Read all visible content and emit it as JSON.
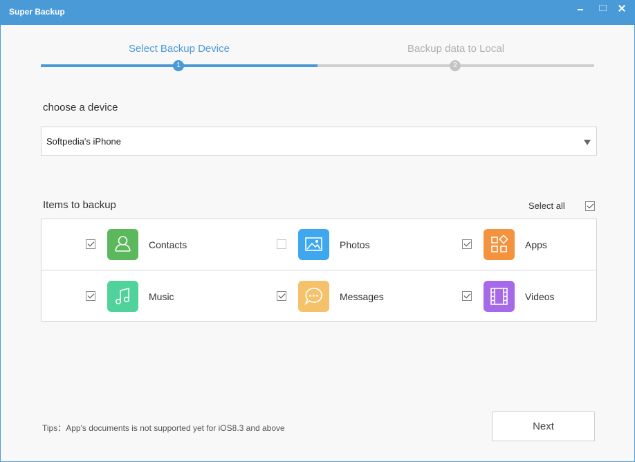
{
  "window": {
    "title": "Super Backup"
  },
  "steps": [
    {
      "number": "1",
      "label": "Select Backup Device",
      "active": true
    },
    {
      "number": "2",
      "label": "Backup data to Local",
      "active": false
    }
  ],
  "device": {
    "heading": "choose a device",
    "selected": "Softpedia's iPhone"
  },
  "backup": {
    "heading": "Items to backup",
    "select_all_label": "Select all",
    "select_all_checked": true,
    "items": [
      {
        "label": "Contacts",
        "checked": true,
        "icon": "contacts-icon",
        "color": "#5cb85c"
      },
      {
        "label": "Photos",
        "checked": false,
        "icon": "photos-icon",
        "color": "#3fa7ee"
      },
      {
        "label": "Apps",
        "checked": true,
        "icon": "apps-icon",
        "color": "#f5923e"
      },
      {
        "label": "Music",
        "checked": true,
        "icon": "music-icon",
        "color": "#4fd39a"
      },
      {
        "label": "Messages",
        "checked": true,
        "icon": "messages-icon",
        "color": "#f5c26b"
      },
      {
        "label": "Videos",
        "checked": true,
        "icon": "videos-icon",
        "color": "#a66ae8"
      }
    ]
  },
  "tips": "Tips：App's documents is not supported yet for iOS8.3 and above",
  "buttons": {
    "next": "Next"
  },
  "colors": {
    "accent": "#4a9ad8",
    "inactive": "#c4c4c4"
  }
}
